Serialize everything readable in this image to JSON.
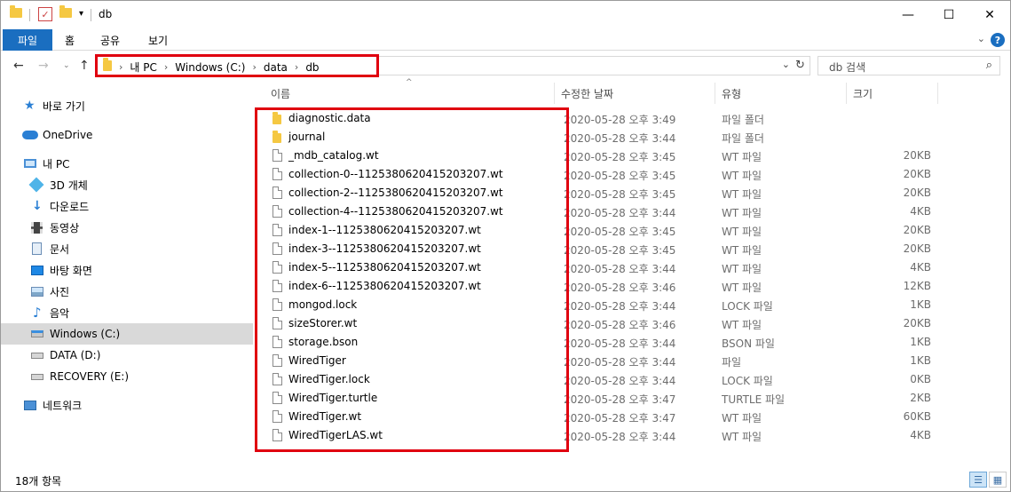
{
  "window": {
    "title": "db",
    "controls": {
      "minimize": "—",
      "maximize": "☐",
      "close": "✕"
    }
  },
  "ribbon": {
    "file_tab": "파일",
    "tabs": [
      "홈",
      "공유",
      "보기"
    ],
    "help": "?"
  },
  "address": {
    "breadcrumbs": [
      "내 PC",
      "Windows (C:)",
      "data",
      "db"
    ],
    "search_placeholder": "db 검색"
  },
  "nav_pane": {
    "items": [
      {
        "label": "바로 가기",
        "icon": "star-icon"
      },
      {
        "label": "OneDrive",
        "icon": "cloud-icon"
      },
      {
        "label": "내 PC",
        "icon": "computer-icon"
      },
      {
        "label": "3D 개체",
        "icon": "3d-objects-icon"
      },
      {
        "label": "다운로드",
        "icon": "download-icon"
      },
      {
        "label": "동영상",
        "icon": "video-icon"
      },
      {
        "label": "문서",
        "icon": "document-icon"
      },
      {
        "label": "바탕 화면",
        "icon": "desktop-icon"
      },
      {
        "label": "사진",
        "icon": "picture-icon"
      },
      {
        "label": "음악",
        "icon": "music-icon"
      },
      {
        "label": "Windows (C:)",
        "icon": "drive-icon",
        "selected": true
      },
      {
        "label": "DATA (D:)",
        "icon": "drive-icon"
      },
      {
        "label": "RECOVERY (E:)",
        "icon": "drive-icon"
      },
      {
        "label": "네트워크",
        "icon": "network-icon"
      }
    ]
  },
  "columns": {
    "name": "이름",
    "modified": "수정한 날짜",
    "type": "유형",
    "size": "크기"
  },
  "files": [
    {
      "name": "diagnostic.data",
      "date": "2020-05-28 오후 3:49",
      "type": "파일 폴더",
      "size": "",
      "is_folder": true
    },
    {
      "name": "journal",
      "date": "2020-05-28 오후 3:44",
      "type": "파일 폴더",
      "size": "",
      "is_folder": true
    },
    {
      "name": "_mdb_catalog.wt",
      "date": "2020-05-28 오후 3:45",
      "type": "WT 파일",
      "size": "20KB"
    },
    {
      "name": "collection-0--1125380620415203207.wt",
      "date": "2020-05-28 오후 3:45",
      "type": "WT 파일",
      "size": "20KB"
    },
    {
      "name": "collection-2--1125380620415203207.wt",
      "date": "2020-05-28 오후 3:45",
      "type": "WT 파일",
      "size": "20KB"
    },
    {
      "name": "collection-4--1125380620415203207.wt",
      "date": "2020-05-28 오후 3:44",
      "type": "WT 파일",
      "size": "4KB"
    },
    {
      "name": "index-1--1125380620415203207.wt",
      "date": "2020-05-28 오후 3:45",
      "type": "WT 파일",
      "size": "20KB"
    },
    {
      "name": "index-3--1125380620415203207.wt",
      "date": "2020-05-28 오후 3:45",
      "type": "WT 파일",
      "size": "20KB"
    },
    {
      "name": "index-5--1125380620415203207.wt",
      "date": "2020-05-28 오후 3:44",
      "type": "WT 파일",
      "size": "4KB"
    },
    {
      "name": "index-6--1125380620415203207.wt",
      "date": "2020-05-28 오후 3:46",
      "type": "WT 파일",
      "size": "12KB"
    },
    {
      "name": "mongod.lock",
      "date": "2020-05-28 오후 3:44",
      "type": "LOCK 파일",
      "size": "1KB"
    },
    {
      "name": "sizeStorer.wt",
      "date": "2020-05-28 오후 3:46",
      "type": "WT 파일",
      "size": "20KB"
    },
    {
      "name": "storage.bson",
      "date": "2020-05-28 오후 3:44",
      "type": "BSON 파일",
      "size": "1KB"
    },
    {
      "name": "WiredTiger",
      "date": "2020-05-28 오후 3:44",
      "type": "파일",
      "size": "1KB"
    },
    {
      "name": "WiredTiger.lock",
      "date": "2020-05-28 오후 3:44",
      "type": "LOCK 파일",
      "size": "0KB"
    },
    {
      "name": "WiredTiger.turtle",
      "date": "2020-05-28 오후 3:47",
      "type": "TURTLE 파일",
      "size": "2KB"
    },
    {
      "name": "WiredTiger.wt",
      "date": "2020-05-28 오후 3:47",
      "type": "WT 파일",
      "size": "60KB"
    },
    {
      "name": "WiredTigerLAS.wt",
      "date": "2020-05-28 오후 3:44",
      "type": "WT 파일",
      "size": "4KB"
    }
  ],
  "status": {
    "item_count": "18개 항목"
  },
  "colors": {
    "accent": "#1a6ec0",
    "highlight": "#e0000f",
    "folder": "#f5c842",
    "selected_bg": "#d9d9d9"
  }
}
